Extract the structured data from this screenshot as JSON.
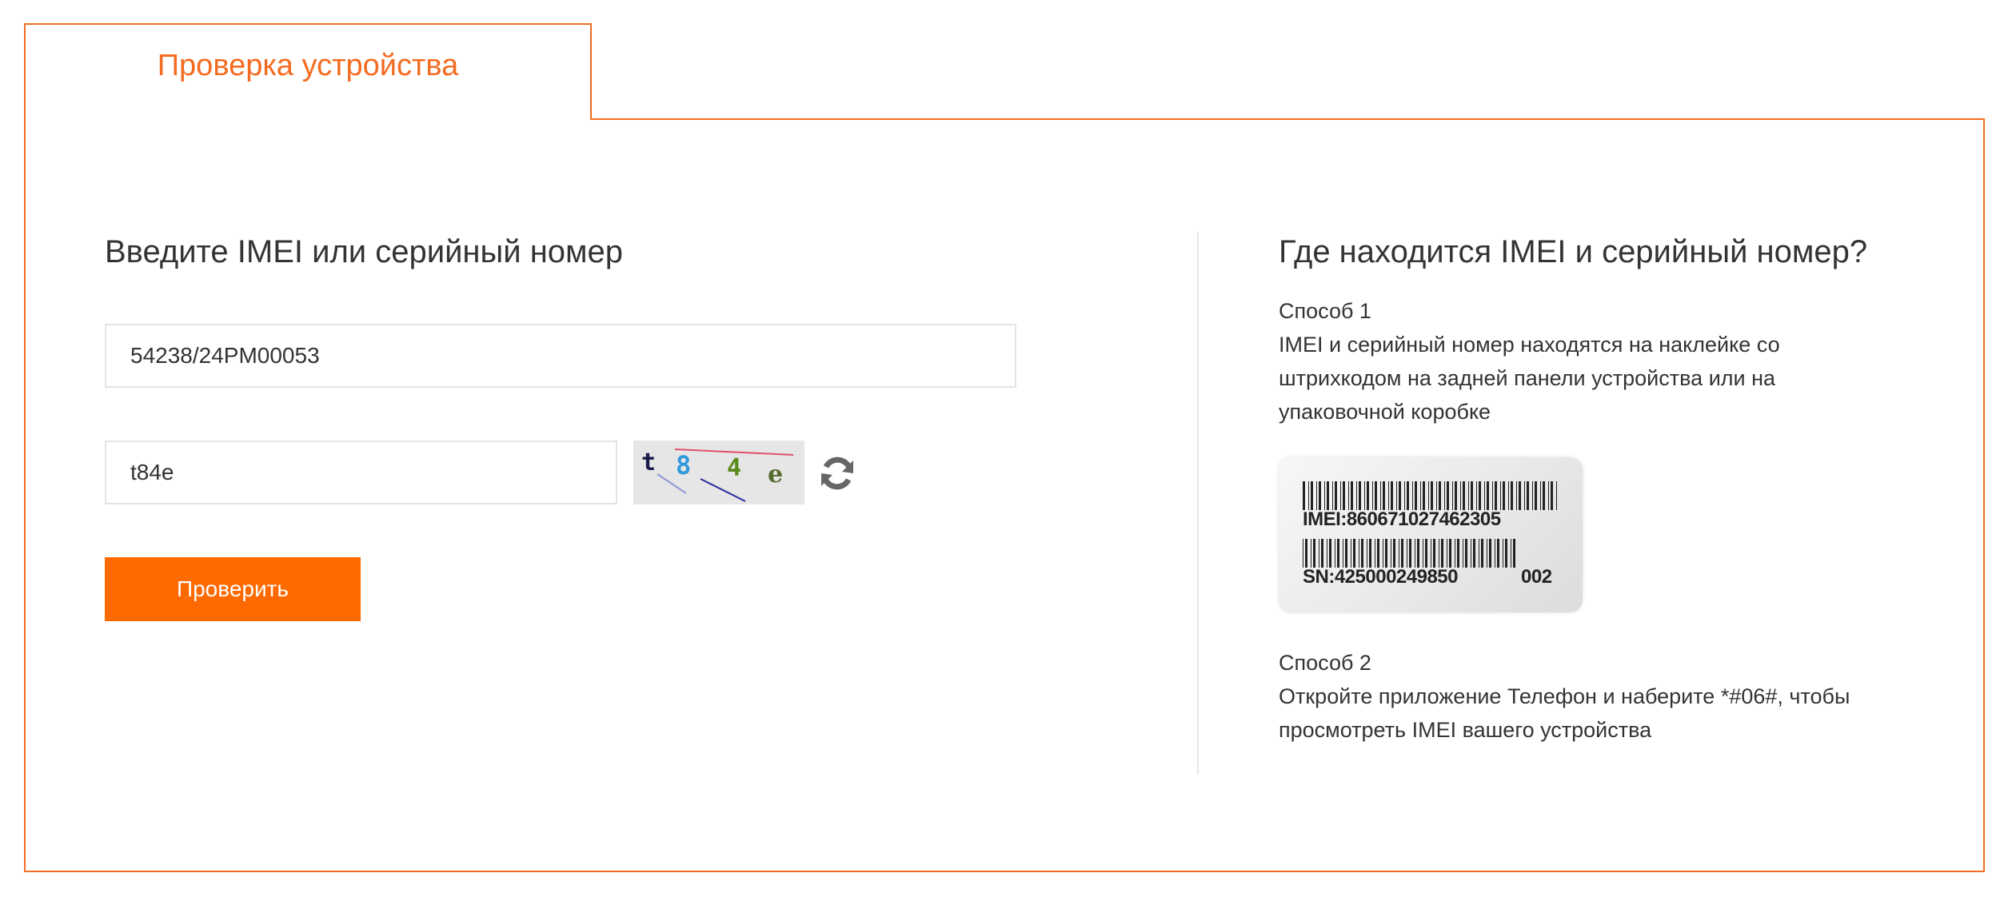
{
  "tab": {
    "label": "Проверка устройства"
  },
  "form": {
    "heading": "Введите IMEI или серийный номер",
    "imei_value": "54238/24PM00053",
    "captcha_value": "t84e",
    "captcha_chars": [
      "t",
      "8",
      "4",
      "e"
    ],
    "check_button_label": "Проверить"
  },
  "help": {
    "heading": "Где находится IMEI и серийный номер?",
    "method1_title": "Способ 1",
    "method1_text_lines": [
      "IMEI и серийный номер находятся на наклейке со",
      "штрихкодом на задней панели устройства или на",
      "упаковочной коробке"
    ],
    "sticker": {
      "imei_label": "IMEI:860671027462305",
      "sn_label": "SN:425000249850",
      "code": "002"
    },
    "method2_title": "Способ 2",
    "method2_text_lines": [
      "Откройте приложение Телефон и наберите *#06#, чтобы",
      "просмотреть IMEI вашего устройства"
    ]
  },
  "colors": {
    "accent": "#f36c21",
    "button": "#ff6a00",
    "text": "#333333",
    "border": "#e4e4e4"
  },
  "icons": {
    "refresh": "refresh-icon"
  }
}
